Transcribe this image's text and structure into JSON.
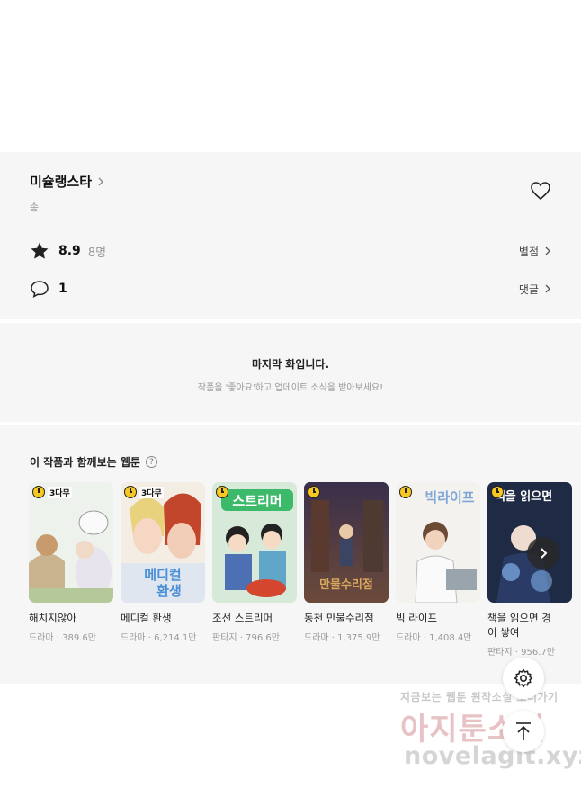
{
  "series": {
    "title": "미슐랭스타",
    "author": "송"
  },
  "rating": {
    "score": "8.9",
    "count": "8명",
    "link_label": "별점"
  },
  "comments": {
    "count": "1",
    "link_label": "댓글"
  },
  "last_episode": {
    "title": "마지막 화입니다.",
    "subtitle": "작품을 '좋아요'하고 업데이트 소식을 받아보세요!"
  },
  "recommendations": {
    "heading": "이 작품과 함께보는 웹툰",
    "help_icon": "?",
    "items": [
      {
        "badge": "3다무",
        "title": "해치지않아",
        "meta": "드라마 · 389.6만"
      },
      {
        "badge": "3다무",
        "title": "메디컬 환생",
        "meta": "드라마 · 6,214.1만"
      },
      {
        "badge": "",
        "title": "조선 스트리머",
        "meta": "판타지 · 796.6만"
      },
      {
        "badge": "",
        "title": "동천 만물수리점",
        "meta": "드라마 · 1,375.9만"
      },
      {
        "badge": "",
        "title": "빅 라이프",
        "meta": "드라마 · 1,408.4만"
      },
      {
        "badge": "",
        "title": "책을 읽으면 경",
        "title2": "이 쌓여",
        "meta": "판타지 · 956.7만"
      }
    ]
  },
  "watermark": {
    "line1": "지금보는 웹툰 원작소설 보러가기",
    "line2": "아지툰소설",
    "line3": "novelagit.xyz"
  },
  "colors": {
    "panel_bg": "#f6f6f6",
    "badge_yellow": "#f7c81f"
  }
}
